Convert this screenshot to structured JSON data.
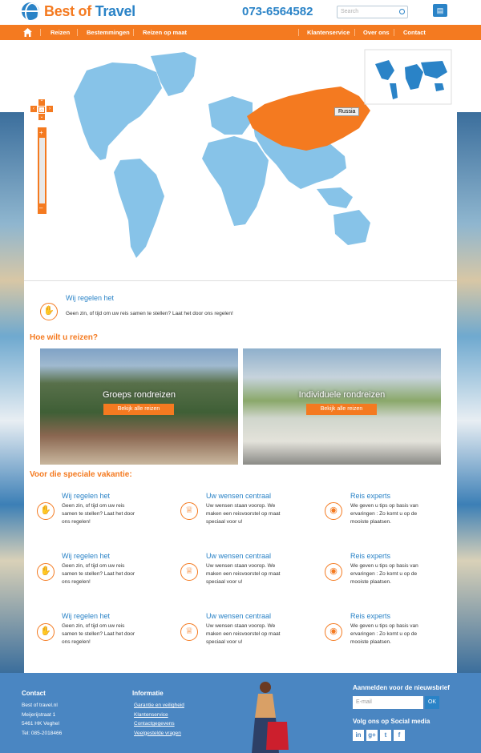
{
  "header": {
    "logo_part1": "Best",
    "logo_part2": "of",
    "logo_part3": "Travel",
    "phone": "073-6564582",
    "search_placeholder": "Search"
  },
  "nav": {
    "left": [
      "Reizen",
      "Bestemmingen",
      "Reizen op maat"
    ],
    "right": [
      "Klantenservice",
      "Over ons",
      "Contact"
    ]
  },
  "map": {
    "tooltip": "Russia",
    "highlight_color": "#f47a20",
    "land_color": "#87c3e8"
  },
  "intro": {
    "title": "Wij regelen het",
    "text": "Geen zin, of tijd om uw reis samen te stellen? Laat het door ons regelen!"
  },
  "travel": {
    "heading": "Hoe wilt u reizen?",
    "tiles": [
      {
        "title": "Groeps rondreizen",
        "button": "Bekijk alle reizen"
      },
      {
        "title": "Individuele rondreizen",
        "button": "Bekijk alle reizen"
      }
    ]
  },
  "special": {
    "heading": "Voor die speciale vakantie:",
    "features": [
      {
        "title": "Wij regelen het",
        "text": "Geen zin, of tijd om uw reis samen te stellen? Laat het door ons regelen!",
        "icon": "thumbs-up-icon"
      },
      {
        "title": "Uw wensen centraal",
        "text": "Uw wensen staan voorop. We maken een reisvoorstel op maat speciaal voor u!",
        "icon": "crown-icon"
      },
      {
        "title": "Reis experts",
        "text": "We geven u tips op basis van ervaringen : Zo komt u op de mooiste plaatsen.",
        "icon": "globe-icon"
      },
      {
        "title": "Wij regelen het",
        "text": "Geen zin, of tijd om uw reis samen te stellen? Laat het door ons regelen!",
        "icon": "thumbs-up-icon"
      },
      {
        "title": "Uw wensen centraal",
        "text": "Uw wensen staan voorop. We maken een reisvoorstel op maat speciaal voor u!",
        "icon": "crown-icon"
      },
      {
        "title": "Reis experts",
        "text": "We geven u tips op basis van ervaringen : Zo komt u op de mooiste plaatsen.",
        "icon": "globe-icon"
      },
      {
        "title": "Wij regelen het",
        "text": "Geen zin, of tijd om uw reis samen te stellen? Laat het door ons regelen!",
        "icon": "thumbs-up-icon"
      },
      {
        "title": "Uw wensen centraal",
        "text": "Uw wensen staan voorop. We maken een reisvoorstel op maat speciaal voor u!",
        "icon": "crown-icon"
      },
      {
        "title": "Reis experts",
        "text": "We geven u tips op basis van ervaringen : Zo komt u op de mooiste plaatsen.",
        "icon": "globe-icon"
      }
    ]
  },
  "footer": {
    "contact": {
      "heading": "Contact",
      "lines": [
        "Best of travel.nl",
        "Meijerijstraat 1",
        "5461 HK Veghel",
        "Tel: 085-2018466"
      ]
    },
    "info": {
      "heading": "Informatie",
      "links": [
        "Garantie en veiligheid",
        "Klantenservice",
        "Contactgegevens",
        "Veelgestelde vragen"
      ]
    },
    "newsletter": {
      "heading": "Aanmelden voor de nieuwsbrief",
      "placeholder": "E-mail",
      "button": "OK"
    },
    "social": {
      "heading": "Volg ons op Social media",
      "icons": [
        "in",
        "g+",
        "t",
        "f"
      ]
    }
  }
}
